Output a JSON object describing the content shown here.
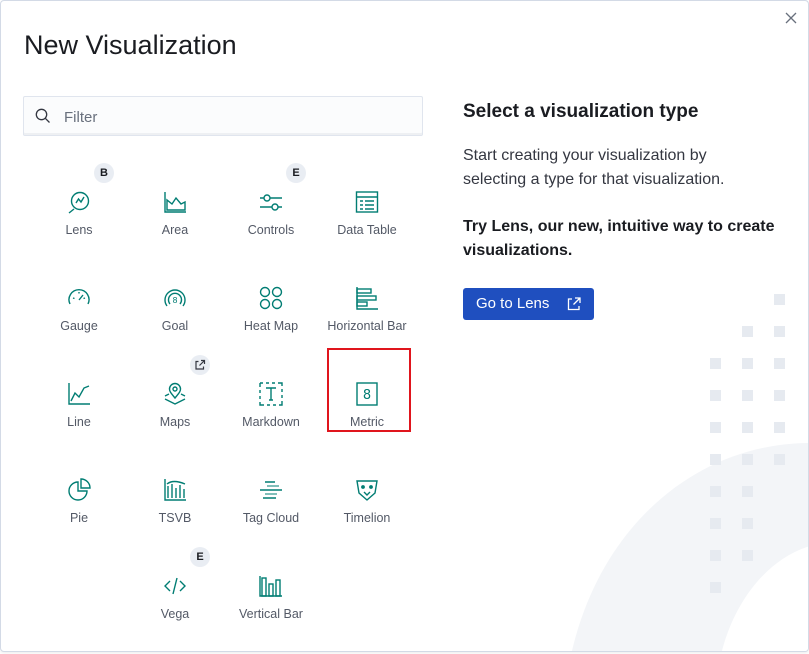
{
  "modal": {
    "title": "New Visualization",
    "close_icon": "close-icon"
  },
  "search": {
    "placeholder": "Filter",
    "value": "",
    "icon": "search-icon"
  },
  "visualizations": [
    {
      "label": "Lens",
      "icon": "lens-icon",
      "badge": "B"
    },
    {
      "label": "Area",
      "icon": "area-chart-icon",
      "badge": ""
    },
    {
      "label": "Controls",
      "icon": "controls-icon",
      "badge": "E"
    },
    {
      "label": "Data Table",
      "icon": "data-table-icon",
      "badge": ""
    },
    {
      "label": "Gauge",
      "icon": "gauge-icon",
      "badge": ""
    },
    {
      "label": "Goal",
      "icon": "goal-icon",
      "badge": ""
    },
    {
      "label": "Heat Map",
      "icon": "heat-map-icon",
      "badge": ""
    },
    {
      "label": "Horizontal Bar",
      "icon": "horizontal-bar-icon",
      "badge": ""
    },
    {
      "label": "Line",
      "icon": "line-chart-icon",
      "badge": ""
    },
    {
      "label": "Maps",
      "icon": "maps-icon",
      "badge": "external-link"
    },
    {
      "label": "Markdown",
      "icon": "markdown-icon",
      "badge": ""
    },
    {
      "label": "Metric",
      "icon": "metric-icon",
      "badge": "",
      "highlighted": true
    },
    {
      "label": "Pie",
      "icon": "pie-chart-icon",
      "badge": ""
    },
    {
      "label": "TSVB",
      "icon": "tsvb-icon",
      "badge": ""
    },
    {
      "label": "Tag Cloud",
      "icon": "tag-cloud-icon",
      "badge": ""
    },
    {
      "label": "Timelion",
      "icon": "timelion-icon",
      "badge": ""
    },
    {
      "label": "Vega",
      "icon": "vega-icon",
      "badge": "E"
    },
    {
      "label": "Vertical Bar",
      "icon": "vertical-bar-icon",
      "badge": ""
    }
  ],
  "info_panel": {
    "title": "Select a visualization type",
    "description": "Start creating your visualization by selecting a type for that visualization.",
    "lens_promo": "Try Lens, our new, intuitive way to create visualizations.",
    "lens_button": "Go to Lens",
    "lens_button_icon": "external-link-icon"
  },
  "colors": {
    "icon_green": "#017d73",
    "primary_button": "#1f4fbf",
    "highlight_border": "#e0151d",
    "badge_bg": "#e9edf3",
    "decoration": "#e9edf3"
  }
}
